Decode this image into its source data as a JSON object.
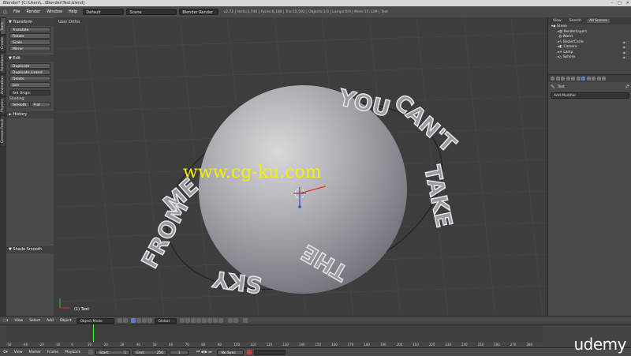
{
  "window": {
    "title": "Blender* [C:\\Users\\...\\Blender\\Text.blend]",
    "controls": [
      "–",
      "□",
      "✕"
    ]
  },
  "menubar": {
    "items": [
      "File",
      "Render",
      "Window",
      "Help"
    ],
    "layout": "Default",
    "scene": "Scene",
    "engine": "Blender Render",
    "stats": "v2.72 | Verts:5,746 | Faces:6,188 | Tris:10,592 | Objects:1/3 | Lamps:0/0 | Mem:15.13M | Text"
  },
  "left_tabs": [
    "Tools",
    "Create",
    "Relations",
    "Animation",
    "Physics",
    "Grease Pencil"
  ],
  "toolshelf": {
    "transform_header": "▼ Transform",
    "transform_buttons": [
      "Translate",
      "Rotate",
      "Scale",
      "Mirror"
    ],
    "edit_header": "▼ Edit",
    "edit_buttons": [
      "Duplicate",
      "Duplicate Linked",
      "Delete",
      "Join"
    ],
    "set_origin": "Set Origin",
    "shading_label": "Shading:",
    "shading_buttons": [
      "Smooth",
      "Flat"
    ],
    "history_header": "► History",
    "smooth_header": "▼ Shade Smooth"
  },
  "viewport": {
    "view_label": "User Ortho",
    "object_label": "(1) Text",
    "watermark": "www.cg-ku.com",
    "curved_text": [
      "FROM",
      "ME",
      "YOU",
      "CAN'T",
      "TAKE",
      "THE",
      "SKY"
    ]
  },
  "outliner": {
    "tabs": [
      "View",
      "Search",
      "All Scenes"
    ],
    "items": [
      {
        "label": "Scene",
        "indent": 0
      },
      {
        "label": "RenderLayers",
        "indent": 1
      },
      {
        "label": "World",
        "indent": 1
      },
      {
        "label": "BezierCircle",
        "indent": 1
      },
      {
        "label": "Camera",
        "indent": 1
      },
      {
        "label": "Lamp",
        "indent": 1
      },
      {
        "label": "Sphere",
        "indent": 1
      }
    ]
  },
  "properties": {
    "object_name": "Text",
    "add_modifier": "Add Modifier"
  },
  "view3d_header": {
    "menus": [
      "View",
      "Select",
      "Add",
      "Object"
    ],
    "mode": "Object Mode",
    "orientation": "Global"
  },
  "timeline": {
    "ticks": [
      "-50",
      "-40",
      "-20",
      "-10",
      "0",
      "10",
      "20",
      "30",
      "40",
      "50",
      "60",
      "70",
      "80",
      "90",
      "100",
      "110",
      "120",
      "130",
      "140",
      "150",
      "160",
      "170",
      "180",
      "190",
      "200",
      "210",
      "220",
      "230",
      "240",
      "250",
      "260",
      "270",
      "280"
    ],
    "current_frame": 1,
    "footer": {
      "menus": [
        "View",
        "Marker",
        "Frame",
        "Playback"
      ],
      "start": "Start:",
      "start_val": "1",
      "end": "End:",
      "end_val": "250",
      "frame_val": "1",
      "sync": "No Sync"
    }
  },
  "branding": "udemy",
  "colors": {
    "accent_blue": "#5680c2",
    "watermark_yellow": "#f5f000",
    "frame_cursor": "#44ff44"
  }
}
